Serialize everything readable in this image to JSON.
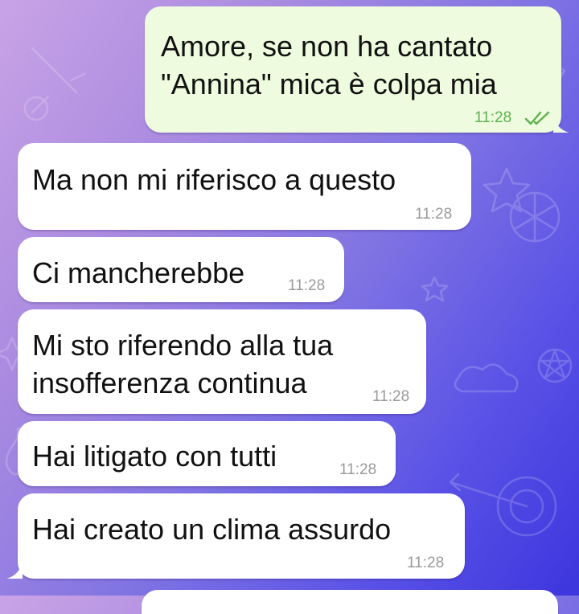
{
  "colors": {
    "incoming_bubble": "#ffffff",
    "outgoing_bubble": "#eefbdf",
    "outgoing_time": "#5fb14f",
    "incoming_time": "#9a9a9a",
    "wallpaper_start": "#c9a3e6",
    "wallpaper_end": "#3d35dd"
  },
  "messages": [
    {
      "direction": "outgoing",
      "lines": [
        "Amore, se non ha cantato",
        "\"Annina\" mica è colpa mia"
      ],
      "time": "11:28",
      "status_icon": "double-check-icon"
    },
    {
      "direction": "incoming",
      "lines": [
        "Ma non mi riferisco a questo"
      ],
      "time": "11:28"
    },
    {
      "direction": "incoming",
      "lines": [
        "Ci mancherebbe"
      ],
      "time": "11:28"
    },
    {
      "direction": "incoming",
      "lines": [
        "Mi sto riferendo alla tua",
        "insofferenza continua"
      ],
      "time": "11:28"
    },
    {
      "direction": "incoming",
      "lines": [
        "Hai litigato con tutti"
      ],
      "time": "11:28"
    },
    {
      "direction": "incoming",
      "lines": [
        "Hai creato un clima assurdo"
      ],
      "time": "11:28"
    }
  ]
}
